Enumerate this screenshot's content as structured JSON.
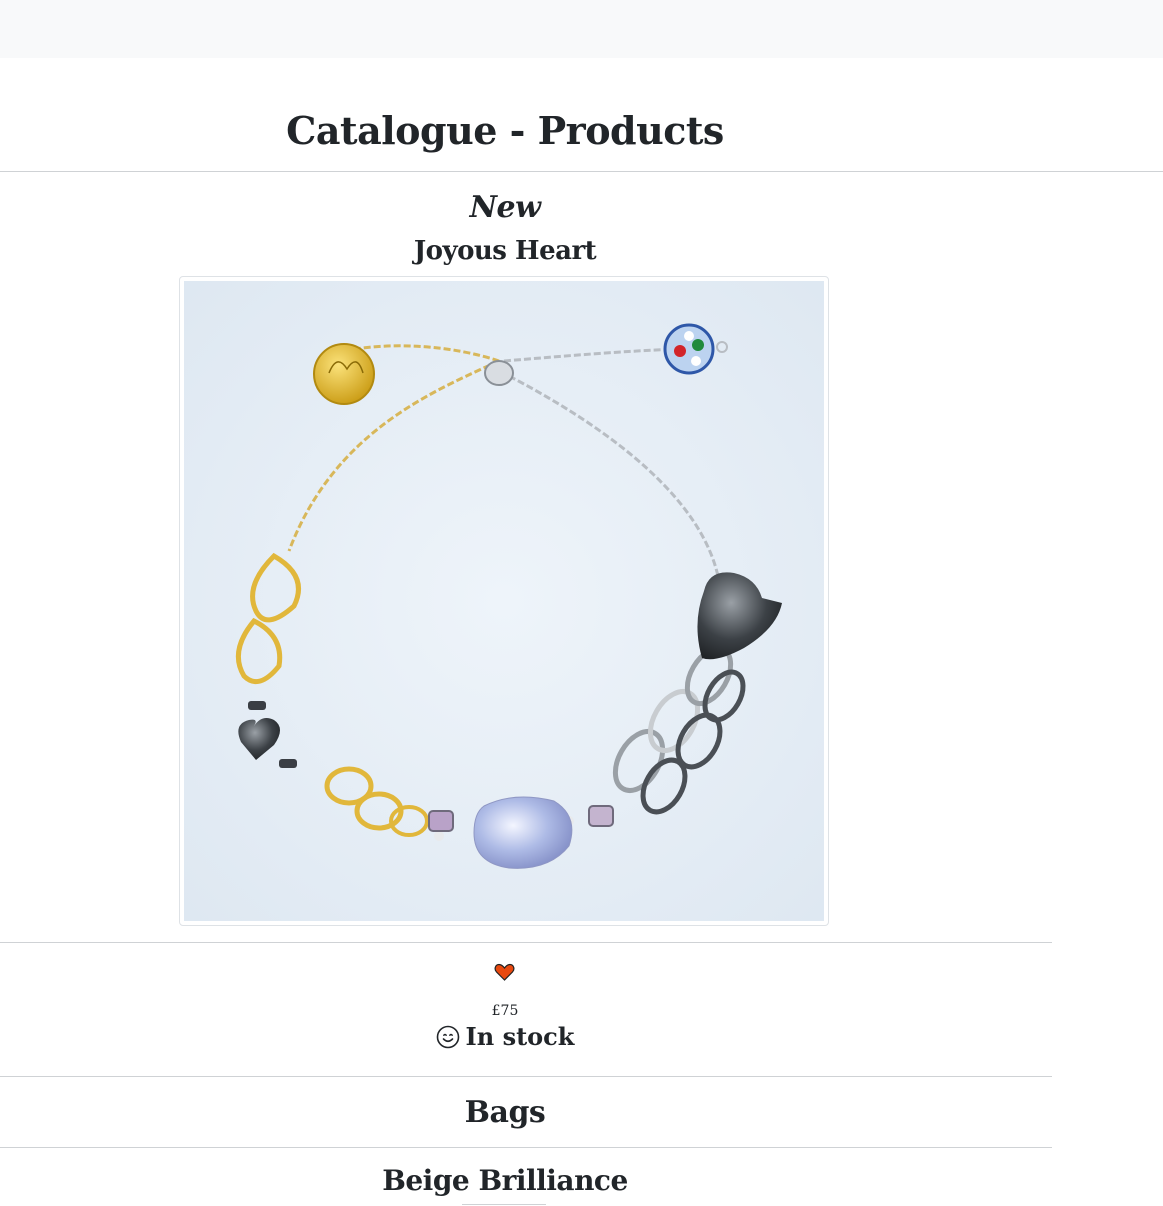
{
  "page": {
    "title": "Catalogue - Products"
  },
  "featured": {
    "badge": "New",
    "name": "Joyous Heart",
    "image_icon": "bracelet-photo",
    "favourite_icon": "heart-icon",
    "favourite_color": "#e8490f",
    "price": "£75",
    "stock_icon": "smile-icon",
    "stock_status": "In stock"
  },
  "categories": [
    {
      "name": "Bags",
      "products": [
        {
          "name": "Beige Brilliance"
        }
      ]
    }
  ]
}
